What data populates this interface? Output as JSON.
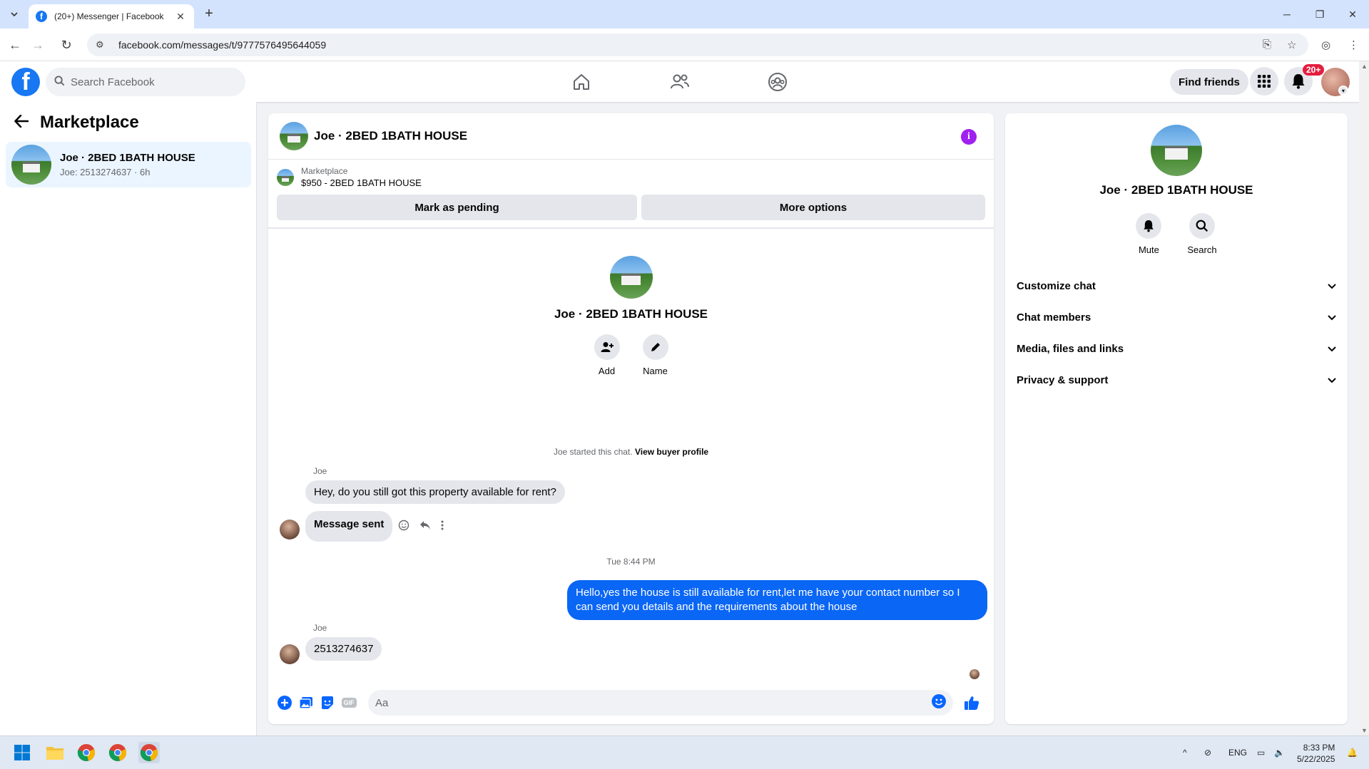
{
  "browser": {
    "tab_title": "(20+) Messenger | Facebook",
    "url": "facebook.com/messages/t/9777576495644059"
  },
  "header": {
    "logo": "f",
    "search_placeholder": "Search Facebook",
    "find_friends": "Find friends",
    "notif_badge": "20+"
  },
  "left": {
    "title": "Marketplace",
    "conversations": [
      {
        "name": "Joe · 2BED 1BATH HOUSE",
        "sub": "Joe: 2513274637 · 6h"
      }
    ]
  },
  "chat": {
    "title": "Joe · 2BED 1BATH HOUSE",
    "marketplace_label": "Marketplace",
    "listing": "$950 - 2BED 1BATH HOUSE",
    "mark_pending": "Mark as pending",
    "more_options": "More options",
    "intro_name": "Joe · 2BED 1BATH HOUSE",
    "intro_add": "Add",
    "intro_name_btn": "Name",
    "started_text": "Joe started this chat.",
    "view_buyer": "View buyer profile",
    "messages": [
      {
        "sender": "Joe",
        "text": "Hey, do you still got this property available for rent?"
      },
      {
        "text": "Message sent"
      },
      {
        "timestamp": "Tue 8:44 PM"
      },
      {
        "outgoing": "Hello,yes the house is still available for rent,let me have your contact number   so I can send you details and the requirements about the house"
      },
      {
        "sender": "Joe",
        "text": "2513274637"
      }
    ],
    "composer_placeholder": "Aa",
    "gif_label": "GIF"
  },
  "right": {
    "name": "Joe · 2BED 1BATH HOUSE",
    "mute": "Mute",
    "search": "Search",
    "rows": [
      "Customize chat",
      "Chat members",
      "Media, files and links",
      "Privacy & support"
    ]
  },
  "taskbar": {
    "lang": "ENG",
    "time": "8:33 PM",
    "date": "5/22/2025"
  },
  "colors": {
    "brand": "#1877f2",
    "outgoing_bubble": "#0a66f5",
    "info": "#a020f0",
    "badge": "#e41e3f"
  }
}
